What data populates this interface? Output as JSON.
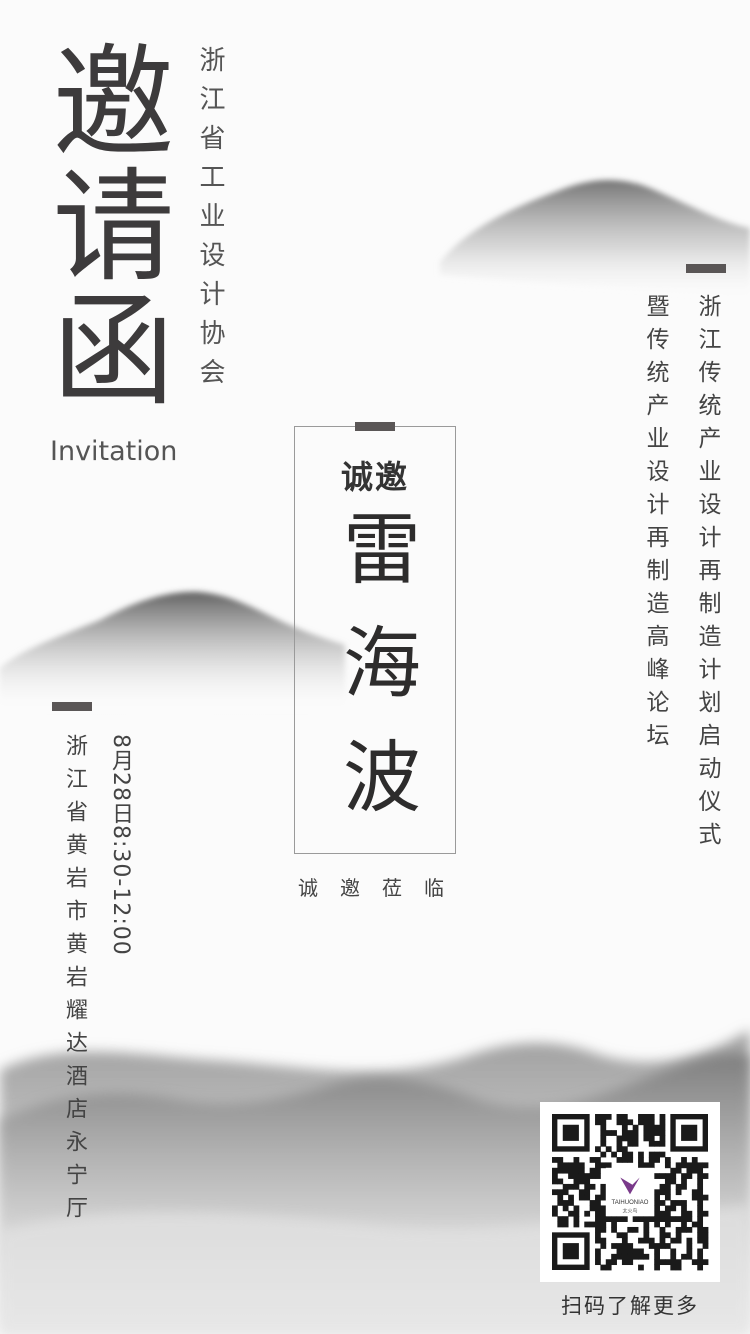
{
  "poster": {
    "title_cn": "邀请函",
    "title_en": "Invitation",
    "organizer": "浙江省工业设计协会",
    "invite_label": "诚邀",
    "guest_name": "雷海波",
    "sincerely_invite": "诚邀莅临",
    "event_line1": "浙江传统产业设计再制造计划启动仪式",
    "event_line2": "暨传统产业设计再制造高峰论坛",
    "time": "8月28日8:30-12:00",
    "venue": "浙江省黄岩市黄岩耀达酒店永宁厅",
    "qr_logo_text": "TAIHUONIAO",
    "qr_logo_sub": "太火鸟",
    "qr_caption": "扫码了解更多"
  },
  "colors": {
    "background": "#fbfbfb",
    "ink_dark": "#3d3b3c",
    "accent_bar": "#5a5656",
    "frame_border": "#9a9a9a"
  }
}
